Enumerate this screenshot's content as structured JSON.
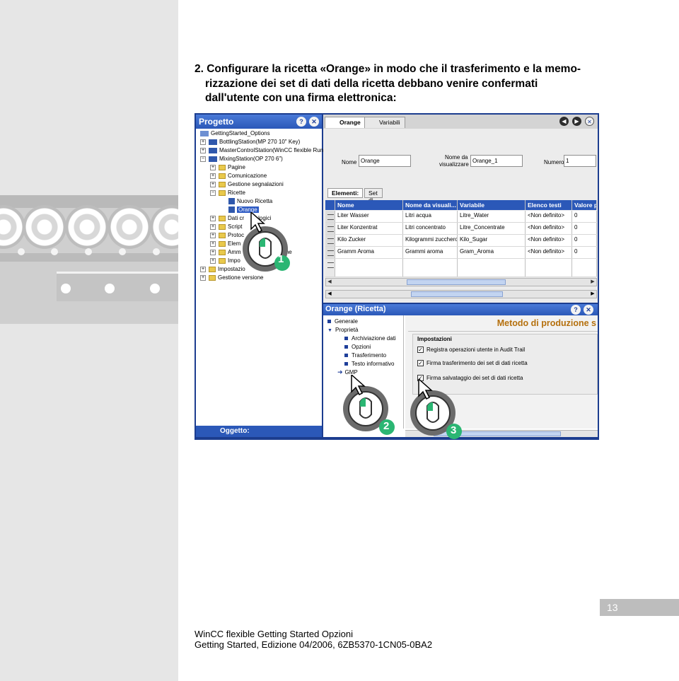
{
  "heading": {
    "line1": "2. Configurare la ricetta «Orange» in modo che il trasferimento e la memo-",
    "line2": "rizzazione dei set di dati della ricetta debbano venire confermati",
    "line3": "dall'utente con una firma elettronica:"
  },
  "screenshot": {
    "project_pane": {
      "title": "Progetto",
      "tree": [
        "GettingStarted_Options",
        "BottlingStation(MP 270 10\" Key)",
        "MasterControlStation(WinCC flexible Runt",
        "MixingStation(OP 270 6\")",
        "Pagine",
        "Comunicazione",
        "Gestione segnalazioni",
        "Ricette",
        "Nuovo Ricetta",
        "Orange",
        "Dati cr",
        "logici",
        "Script",
        "Protoc",
        "Elem",
        "sti",
        "Amm",
        "untime",
        "Impo",
        "ratore",
        "Impostazio",
        "Gestione versione"
      ],
      "footer": "Oggetto:"
    },
    "editor": {
      "tab_active": "Orange",
      "tab_other": "Variabili",
      "fields": {
        "name_label": "Nome",
        "name_value": "Orange",
        "display_label_1": "Nome da",
        "display_label_2": "visualizzare",
        "display_value": "Orange_1",
        "number_label": "Numero",
        "number_value": "1"
      },
      "element_tabs": [
        "Elementi:",
        "Set di dati"
      ],
      "columns": [
        "Nome",
        "Nome da visuali...",
        "Variabile",
        "Elenco testi",
        "Valore p"
      ],
      "rows": [
        [
          "Liter Wasser",
          "Litri acqua",
          "Litre_Water",
          "<Non definito>",
          "0"
        ],
        [
          "Liter Konzentrat",
          "Litri concentrato",
          "Litre_Concentrate",
          "<Non definito>",
          "0"
        ],
        [
          "Kilo Zucker",
          "Kilogrammi zucchero",
          "Kilo_Sugar",
          "<Non definito>",
          "0"
        ],
        [
          "Gramm Aroma",
          "Grammi aroma",
          "Gram_Aroma",
          "<Non definito>",
          "0"
        ]
      ]
    },
    "properties": {
      "title": "Orange (Ricetta)",
      "nav": [
        "Generale",
        "Proprietà",
        "Archiviazione dati",
        "Opzioni",
        "Trasferimento",
        "Testo informativo",
        "GMP"
      ],
      "section_title": "Metodo di produzione s",
      "group_title": "Impostazioni",
      "checkboxes": [
        {
          "label": "Registra operazioni utente in Audit Trail",
          "checked": true
        },
        {
          "label": "Firma trasferimento dei set di dati ricetta",
          "checked": true
        },
        {
          "label": "Firma salvataggio dei set di dati ricetta",
          "checked": true
        }
      ]
    },
    "callouts": [
      "1",
      "2",
      "3"
    ]
  },
  "page_number": "13",
  "footer": {
    "line1": "WinCC flexible Getting Started Opzioni",
    "line2": "Getting Started, Edizione 04/2006, 6ZB5370-1CN05-0BA2"
  },
  "colors": {
    "title_bar": "#2b58b8",
    "method_text": "#b5700d",
    "callout_green": "#2bb673"
  }
}
